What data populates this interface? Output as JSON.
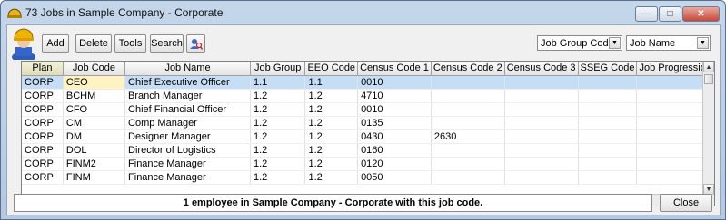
{
  "window": {
    "title": "73 Jobs in Sample Company - Corporate",
    "controls": {
      "minimize": "—",
      "maximize": "□",
      "close": "✕"
    }
  },
  "toolbar": {
    "add_label": "Add",
    "delete_label": "Delete",
    "tools_label": "Tools",
    "search_label": "Search",
    "filter1_value": "Job Group Code",
    "filter2_value": "Job Name"
  },
  "grid": {
    "columns": [
      "Plan",
      "Job Code",
      "Job Name",
      "Job Group",
      "EEO Code",
      "Census Code 1",
      "Census Code 2",
      "Census Code 3",
      "SSEG Code",
      "Job Progression"
    ],
    "rows": [
      [
        "CORP",
        "CEO",
        "Chief Executive Officer",
        "1.1",
        "1.1",
        "0010",
        "",
        "",
        "",
        ""
      ],
      [
        "CORP",
        "BCHM",
        "Branch Manager",
        "1.2",
        "1.2",
        "4710",
        "",
        "",
        "",
        ""
      ],
      [
        "CORP",
        "CFO",
        "Chief Financial Officer",
        "1.2",
        "1.2",
        "0010",
        "",
        "",
        "",
        ""
      ],
      [
        "CORP",
        "CM",
        "Comp Manager",
        "1.2",
        "1.2",
        "0135",
        "",
        "",
        "",
        ""
      ],
      [
        "CORP",
        "DM",
        "Designer Manager",
        "1.2",
        "1.2",
        "0430",
        "2630",
        "",
        "",
        ""
      ],
      [
        "CORP",
        "DOL",
        "Director of Logistics",
        "1.2",
        "1.2",
        "0160",
        "",
        "",
        "",
        ""
      ],
      [
        "CORP",
        "FINM2",
        "Finance Manager",
        "1.2",
        "1.2",
        "0120",
        "",
        "",
        "",
        ""
      ],
      [
        "CORP",
        "FINM",
        "Finance Manager",
        "1.2",
        "1.2",
        "0050",
        "",
        "",
        "",
        ""
      ]
    ]
  },
  "status": {
    "text": "1 employee in Sample Company - Corporate with this job code."
  },
  "footer": {
    "close_label": "Close"
  },
  "icons": {
    "title": "hardhat-icon",
    "avatar": "worker-avatar-icon",
    "people": "people-search-icon"
  }
}
